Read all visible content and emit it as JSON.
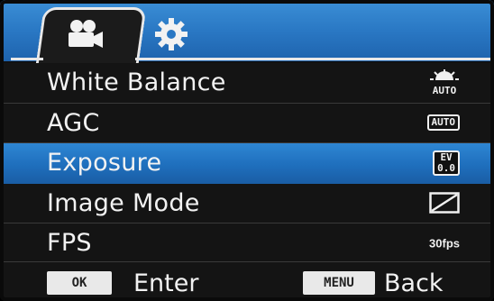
{
  "tabs": [
    {
      "icon": "camera-icon"
    },
    {
      "icon": "gear-icon"
    }
  ],
  "menu": {
    "items": [
      {
        "label": "White Balance",
        "value_icon": "white-balance-auto-icon",
        "value_text": "AUTO"
      },
      {
        "label": "AGC",
        "value_icon": "agc-auto-icon",
        "value_text": "AUTO"
      },
      {
        "label": "Exposure",
        "value_icon": "exposure-ev-icon",
        "value_text": "EV",
        "value_sub": "0.0",
        "selected": true
      },
      {
        "label": "Image Mode",
        "value_icon": "image-mode-icon"
      },
      {
        "label": "FPS",
        "value_icon": "fps-icon",
        "value_text": "30fps"
      }
    ]
  },
  "footer": {
    "ok_key": "OK",
    "ok_action": "Enter",
    "menu_key": "MENU",
    "menu_action": "Back"
  },
  "colors": {
    "accent": "#2a7ecb",
    "background": "#141414",
    "text": "#f2f2f2"
  }
}
